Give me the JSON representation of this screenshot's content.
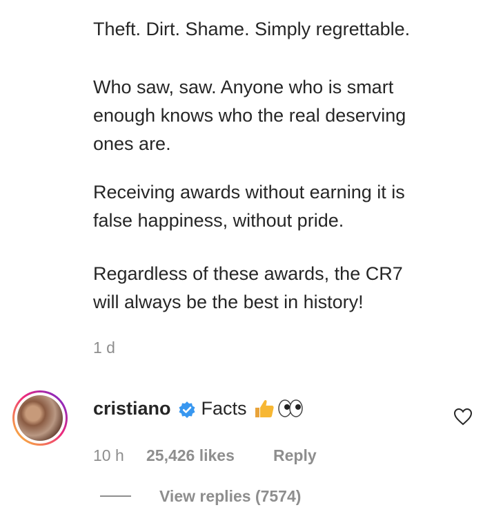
{
  "caption": {
    "paragraphs": [
      "Theft. Dirt. Shame. Simply regrettable.",
      "Who saw, saw. Anyone who is smart",
      "enough knows who the real deserving",
      "ones are.",
      "Receiving awards without earning it is",
      "false happiness, without pride.",
      "Regardless of these awards, the CR7",
      "will always be the best in history!"
    ],
    "time": "1 d"
  },
  "comment": {
    "username": "cristiano",
    "verified_icon": "verified-badge-icon",
    "text": "Facts",
    "emoji_names": [
      "thumbs-up-icon",
      "eyes-icon"
    ],
    "time": "10 h",
    "likes": "25,426 likes",
    "reply_label": "Reply",
    "view_replies": "View replies (7574)",
    "like_icon": "heart-outline-icon"
  },
  "colors": {
    "text": "#262626",
    "secondary": "#8e8e8e",
    "verified": "#3897f0"
  }
}
